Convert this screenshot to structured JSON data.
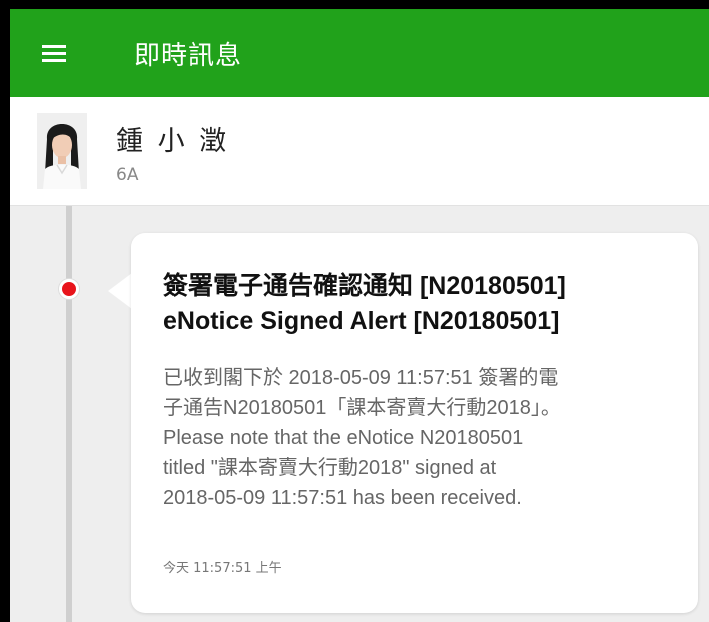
{
  "app_bar": {
    "title": "即時訊息",
    "menu_icon": "hamburger-menu-icon",
    "background": "#21a21b"
  },
  "student": {
    "name": "鍾 小 澂",
    "class": "6A",
    "avatar_icon": "student-avatar"
  },
  "message": {
    "title_line1": "簽署電子通告確認通知 [N20180501]",
    "title_line2": "eNotice Signed Alert [N20180501]",
    "body_line1": "已收到閣下於 2018-05-09 11:57:51 簽署的電",
    "body_line2": "子通告N20180501「課本寄賣大行動2018」。",
    "body_line3": "Please note that the eNotice N20180501",
    "body_line4": "titled \"課本寄賣大行動2018\" signed at",
    "body_line5": "2018-05-09 11:57:51 has been received.",
    "timestamp": "今天 11:57:51 上午",
    "status_dot_color": "#e8141b"
  }
}
